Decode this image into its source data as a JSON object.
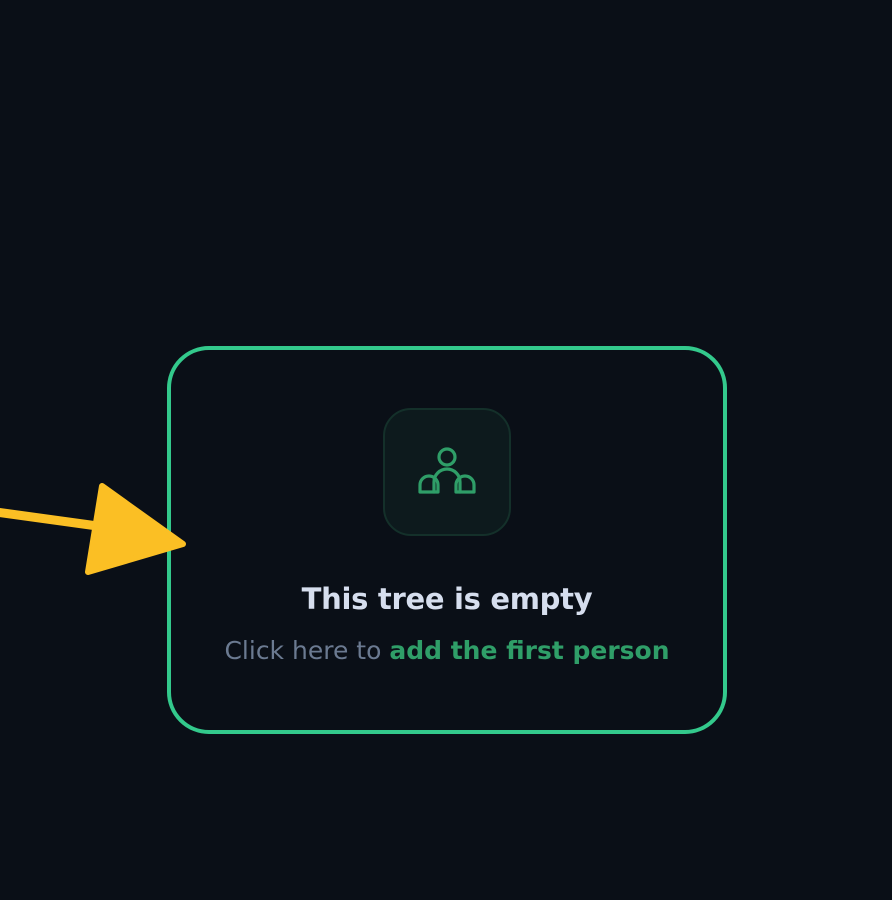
{
  "empty_state": {
    "title": "This tree is empty",
    "subtitle_prefix": "Click here to",
    "subtitle_link": "add the first person",
    "icon": "users-group-icon"
  },
  "annotation": {
    "icon": "arrow-right-icon",
    "color": "#fbbf24"
  },
  "colors": {
    "background": "#0a0f17",
    "card_border": "#33c98c",
    "accent_link": "#2f9e68",
    "icon_stroke": "#2f9e68",
    "title": "#d6deee",
    "subtitle": "#6b7a91"
  }
}
